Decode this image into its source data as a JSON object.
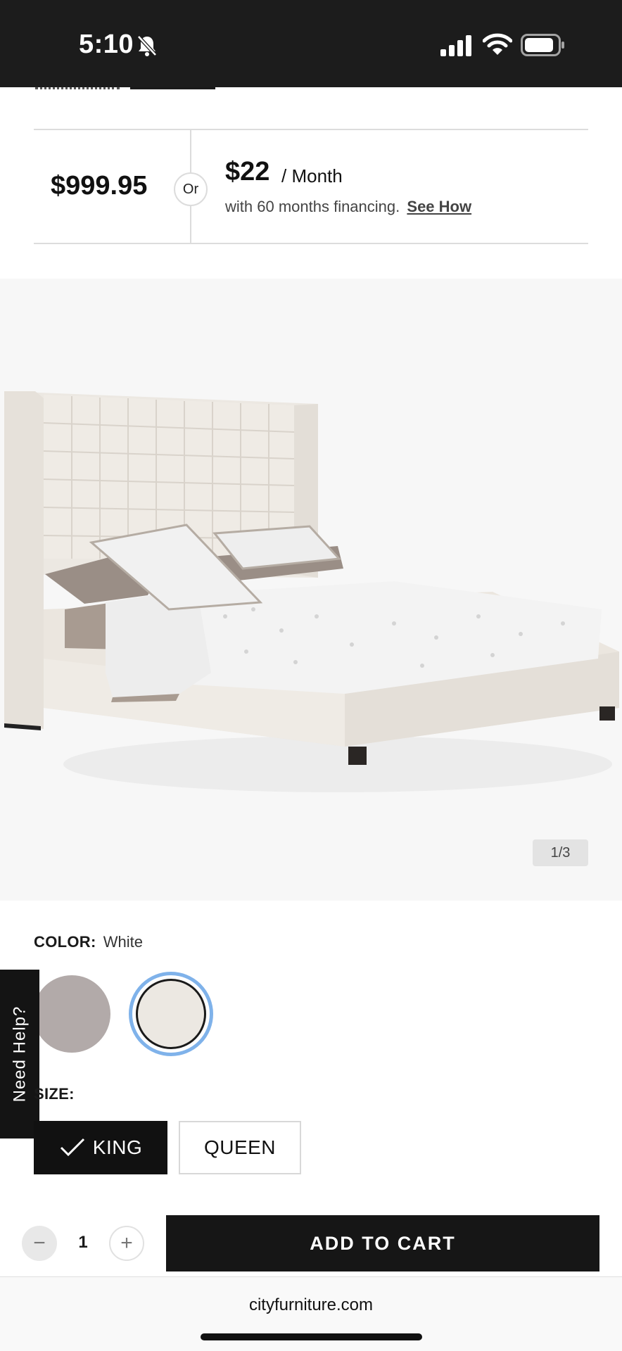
{
  "status_bar": {
    "time": "5:10",
    "icons": [
      "bell-slash-icon",
      "signal-icon",
      "wifi-icon",
      "battery-icon"
    ]
  },
  "pricing": {
    "price": "$999.95",
    "or_label": "Or",
    "monthly_amount": "$22",
    "monthly_period": "/ Month",
    "financing_text": "with 60 months financing.",
    "see_how_label": "See How"
  },
  "gallery": {
    "counter": "1/3"
  },
  "color": {
    "label": "COLOR:",
    "selected_value": "White",
    "swatches": [
      {
        "name": "gray",
        "color": "#b2aaa9",
        "selected": false
      },
      {
        "name": "white",
        "color": "#ece8e2",
        "selected": true
      }
    ],
    "selected_ring_color": "#7fb2ea"
  },
  "need_help": {
    "label": "Need Help?"
  },
  "size": {
    "label": "SIZE:",
    "options": [
      {
        "label": "KING",
        "selected": true
      },
      {
        "label": "QUEEN",
        "selected": false
      }
    ]
  },
  "cart": {
    "quantity": "1",
    "minus_label": "−",
    "plus_label": "+",
    "add_to_cart_label": "ADD TO CART"
  },
  "browser": {
    "url": "cityfurniture.com"
  }
}
